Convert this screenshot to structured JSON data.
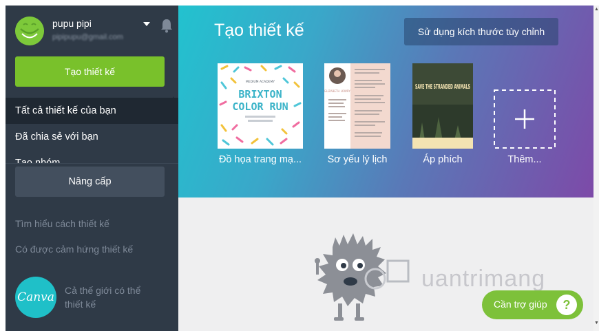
{
  "user": {
    "name": "pupu pipi",
    "email": "pipipupu@gmail.com"
  },
  "sidebar": {
    "create_label": "Tạo thiết kế",
    "nav": [
      {
        "label": "Tất cả thiết kế của bạn",
        "active": true
      },
      {
        "label": "Đã chia sẻ với bạn",
        "active": false
      },
      {
        "label": "Tạo nhóm",
        "active": false
      }
    ],
    "upgrade_label": "Nâng cấp",
    "learn_link": "Tìm hiểu cách thiết kế",
    "inspire_link": "Có được cảm hứng thiết kế",
    "promo_logo": "Canva",
    "promo_text": "Cả thế giới có thể thiết kế"
  },
  "hero": {
    "title": "Tạo thiết kế",
    "custom_size_label": "Sử dụng kích thước tùy chỉnh",
    "templates": [
      {
        "label": "Đồ họa trang mạ...",
        "thumb_title_1": "BRIXTON",
        "thumb_title_2": "COLOR RUN",
        "thumb_sub": "MEDIUM ACADEMY"
      },
      {
        "label": "Sơ yếu lý lịch",
        "thumb_name": "ELIZABETH LOWRY"
      },
      {
        "label": "Áp phích",
        "thumb_title": "SAVE THE STRANDED ANIMALS"
      },
      {
        "label": "Thêm..."
      }
    ]
  },
  "help": {
    "label": "Cần trợ giúp",
    "icon": "?"
  },
  "watermark": "uantrimang",
  "colors": {
    "sidebar": "#2f3a47",
    "accent": "#79c12b",
    "promo": "#1fc0c8"
  }
}
